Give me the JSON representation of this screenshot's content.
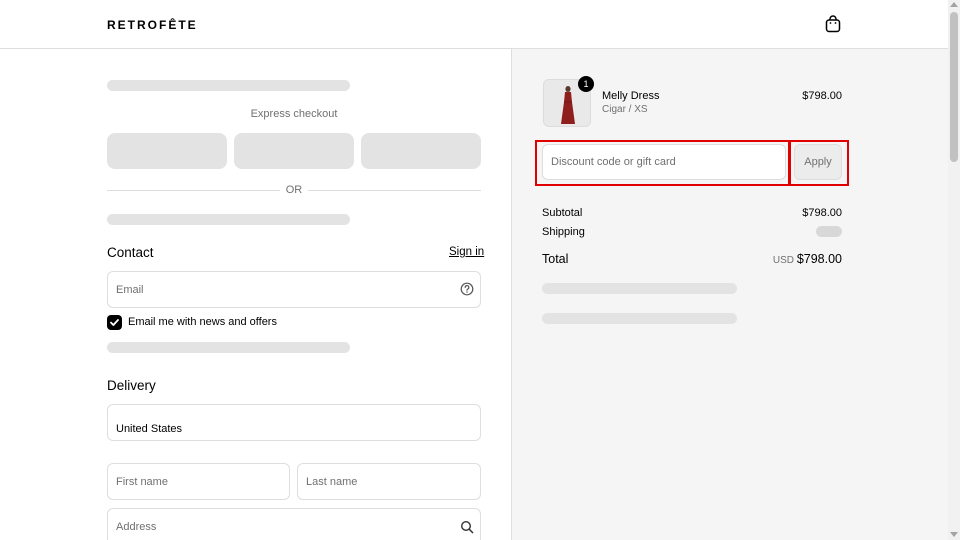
{
  "header": {
    "logo": "RETROFÊTE",
    "cart_icon": "shopping-bag-icon"
  },
  "checkout": {
    "express_label": "Express checkout",
    "or_label": "OR",
    "contact": {
      "heading": "Contact",
      "sign_in": "Sign in",
      "email_placeholder": "Email",
      "email_help_icon": "question-circle-icon",
      "newsletter_label": "Email me with news and offers",
      "newsletter_checked": true
    },
    "delivery": {
      "heading": "Delivery",
      "country_value": "United States",
      "first_name_placeholder": "First name",
      "last_name_placeholder": "Last name",
      "address_placeholder": "Address",
      "address_search_icon": "search-icon"
    }
  },
  "summary": {
    "product": {
      "name": "Melly Dress",
      "variant": "Cigar / XS",
      "price": "$798.00",
      "quantity": "1"
    },
    "discount_placeholder": "Discount code or gift card",
    "apply_label": "Apply",
    "subtotal_label": "Subtotal",
    "subtotal_value": "$798.00",
    "shipping_label": "Shipping",
    "total_label": "Total",
    "currency": "USD",
    "total_value": "$798.00"
  },
  "colors": {
    "highlight": "#e00000",
    "summary_bg": "#f5f5f5",
    "skeleton": "#e3e3e3"
  }
}
